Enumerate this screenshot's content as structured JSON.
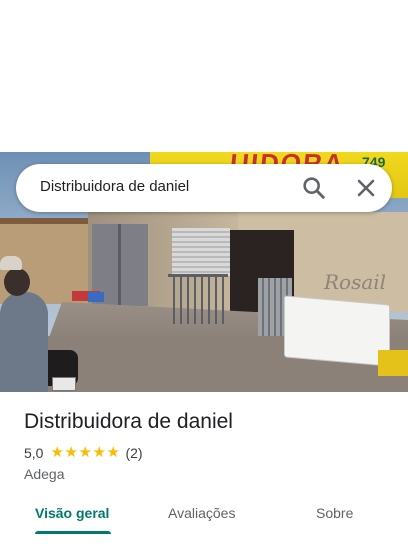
{
  "search": {
    "value": "Distribuidora de daniel"
  },
  "icons": {
    "search": "search-icon",
    "close": "close-icon",
    "star": "star-icon"
  },
  "photo": {
    "sign_text": "UIDORA",
    "sign_phone": "749",
    "graffiti": "Rosail"
  },
  "place": {
    "title": "Distribuidora de daniel",
    "rating": "5,0",
    "stars": 5,
    "review_count": "(2)",
    "category": "Adega"
  },
  "tabs": [
    {
      "label": "Visão geral",
      "active": true
    },
    {
      "label": "Avaliações",
      "active": false
    },
    {
      "label": "Sobre",
      "active": false
    }
  ],
  "colors": {
    "accent": "#00796b",
    "star": "#fbbc04",
    "title": "#202124",
    "secondary": "#5f6368"
  }
}
